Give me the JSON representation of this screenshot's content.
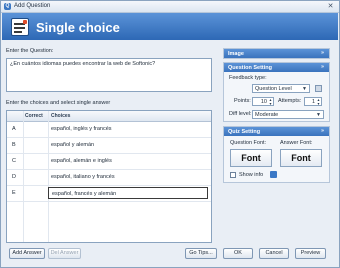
{
  "window": {
    "title": "Add Question",
    "close_glyph": "✕"
  },
  "header": {
    "title": "Single choice",
    "icon": "question-list-icon"
  },
  "question": {
    "label": "Enter the Question:",
    "value": "¿En cuántos idiomas puedes encontrar la web de Softonic?"
  },
  "choices": {
    "label": "Enter the choices and select single answer",
    "columns": {
      "letter": "",
      "correct": "Correct",
      "choices": "Choices"
    },
    "rows": [
      {
        "letter": "A",
        "text": "español, inglés y francés"
      },
      {
        "letter": "B",
        "text": "español y alemán"
      },
      {
        "letter": "C",
        "text": "español, alemán e inglés"
      },
      {
        "letter": "D",
        "text": "español, italiano y francés"
      },
      {
        "letter": "E",
        "text": "español, francés y alemán"
      }
    ]
  },
  "image_panel": {
    "title": "Image",
    "toggle": "»"
  },
  "question_setting": {
    "title": "Question Setting",
    "toggle": "»",
    "feedback_label": "Feedback type:",
    "feedback_value": "Question Level",
    "points_label": "Points:",
    "points_value": "10",
    "attempts_label": "Attempts:",
    "attempts_value": "1",
    "difficulty_label": "Diff level:",
    "difficulty_value": "Moderate"
  },
  "quiz_setting": {
    "title": "Quiz Setting",
    "toggle": "»",
    "question_font_label": "Question Font:",
    "question_font_button": "Font",
    "answer_font_label": "Answer Font:",
    "answer_font_button": "Font",
    "show_info_label": "Show info"
  },
  "buttons": {
    "add_answer": "Add Answer",
    "del_answer": "Del Answer",
    "go_tips": "Go Tips...",
    "ok": "OK",
    "cancel": "Cancel",
    "preview": "Preview"
  },
  "colors": {
    "header": "#2d68b5",
    "panel_header": "#3a73bd",
    "background": "#e9eef5"
  }
}
